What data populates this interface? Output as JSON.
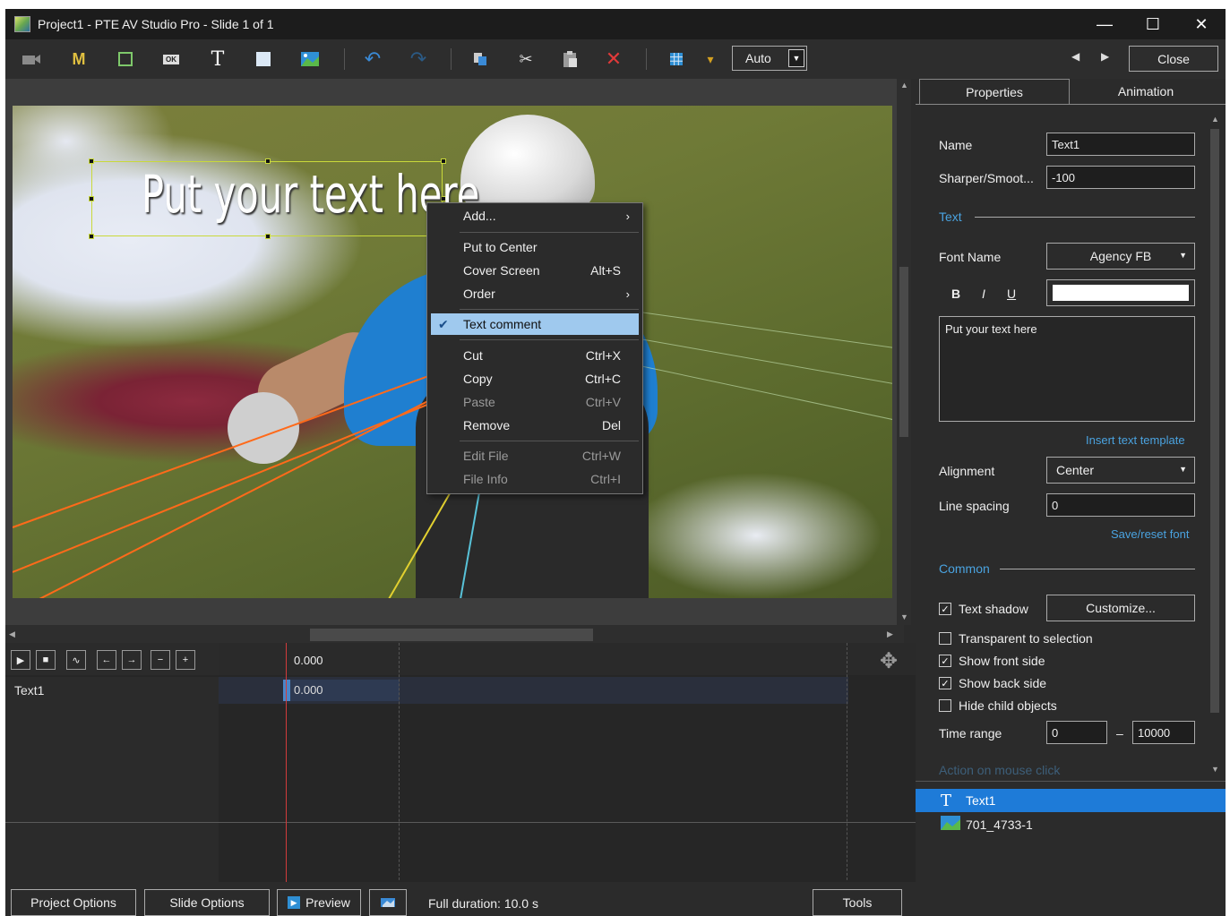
{
  "window": {
    "title": "Project1 - PTE AV Studio Pro - Slide 1 of 1",
    "controls": {
      "minimize": "—",
      "maximize": "☐",
      "close": "✕"
    }
  },
  "toolbar": {
    "icons": [
      "camera-icon",
      "mask-icon",
      "frame-icon",
      "button-object-icon",
      "text-icon",
      "rectangle-icon",
      "image-icon",
      "undo-icon",
      "redo-icon",
      "copy-style-icon",
      "cut-icon",
      "paste-icon",
      "delete-icon",
      "grid-icon",
      "grid-dropdown-icon"
    ],
    "glyphs": {
      "mask": "M",
      "text": "T",
      "button": "OK",
      "undo": "↶",
      "redo": "↷",
      "cut": "✂",
      "delete": "✕",
      "dropdown": "▾"
    },
    "zoom_value": "Auto",
    "close_label": "Close"
  },
  "canvas": {
    "text_object": "Put your text here"
  },
  "context_menu": {
    "items": [
      {
        "label": "Add...",
        "shortcut": "",
        "submenu": true,
        "disabled": false
      },
      {
        "label": "Put to Center",
        "shortcut": "",
        "submenu": false,
        "disabled": false
      },
      {
        "label": "Cover Screen",
        "shortcut": "Alt+S",
        "submenu": false,
        "disabled": false
      },
      {
        "label": "Order",
        "shortcut": "",
        "submenu": true,
        "disabled": false
      },
      {
        "label": "Text comment",
        "shortcut": "",
        "submenu": false,
        "disabled": false,
        "checked": true
      },
      {
        "label": "Cut",
        "shortcut": "Ctrl+X",
        "submenu": false,
        "disabled": false
      },
      {
        "label": "Copy",
        "shortcut": "Ctrl+C",
        "submenu": false,
        "disabled": false
      },
      {
        "label": "Paste",
        "shortcut": "Ctrl+V",
        "submenu": false,
        "disabled": true
      },
      {
        "label": "Remove",
        "shortcut": "Del",
        "submenu": false,
        "disabled": false
      },
      {
        "label": "Edit File",
        "shortcut": "Ctrl+W",
        "submenu": false,
        "disabled": true
      },
      {
        "label": "File Info",
        "shortcut": "Ctrl+I",
        "submenu": false,
        "disabled": true
      }
    ],
    "check_glyph": "✔",
    "submenu_glyph": "›"
  },
  "timeline": {
    "time_top": "0.000",
    "row_label": "Text1",
    "clip_time": "0.000"
  },
  "bottom_bar": {
    "project_options": "Project Options",
    "slide_options": "Slide Options",
    "preview": "Preview",
    "full_duration": "Full duration: 10.0 s",
    "tools": "Tools"
  },
  "properties": {
    "tabs": {
      "properties": "Properties",
      "animation": "Animation"
    },
    "name_label": "Name",
    "name_value": "Text1",
    "sharpen_label": "Sharper/Smoot...",
    "sharpen_value": "-100",
    "section_text": "Text",
    "font_name_label": "Font Name",
    "font_name_value": "Agency FB",
    "bold": "B",
    "italic": "I",
    "underline": "U",
    "text_content": "Put your text here",
    "insert_template": "Insert text template",
    "alignment_label": "Alignment",
    "alignment_value": "Center",
    "line_spacing_label": "Line spacing",
    "line_spacing_value": "0",
    "save_reset_font": "Save/reset font",
    "section_common": "Common",
    "text_shadow": "Text shadow",
    "customize": "Customize...",
    "transparent_to_selection": "Transparent to selection",
    "show_front_side": "Show front side",
    "show_back_side": "Show back side",
    "hide_child_objects": "Hide child objects",
    "time_range_label": "Time range",
    "time_range_from": "0",
    "time_range_dash": "–",
    "time_range_to": "10000",
    "action_on_mouse_click": "Action on mouse click",
    "checks": {
      "text_shadow": true,
      "transparent_to_selection": false,
      "show_front_side": true,
      "show_back_side": true,
      "hide_child_objects": false
    },
    "check_glyph": "✓"
  },
  "objects": [
    {
      "icon": "text-icon",
      "glyph": "T",
      "label": "Text1",
      "selected": true
    },
    {
      "icon": "image-icon",
      "glyph": "",
      "label": "701_4733-1",
      "selected": false
    }
  ],
  "colors": {
    "accent": "#1e7bd8",
    "link": "#4aa3e0",
    "menu_highlight": "#9fc9ee",
    "selection_frame": "#c9d93a",
    "playhead": "#d23b3b"
  }
}
